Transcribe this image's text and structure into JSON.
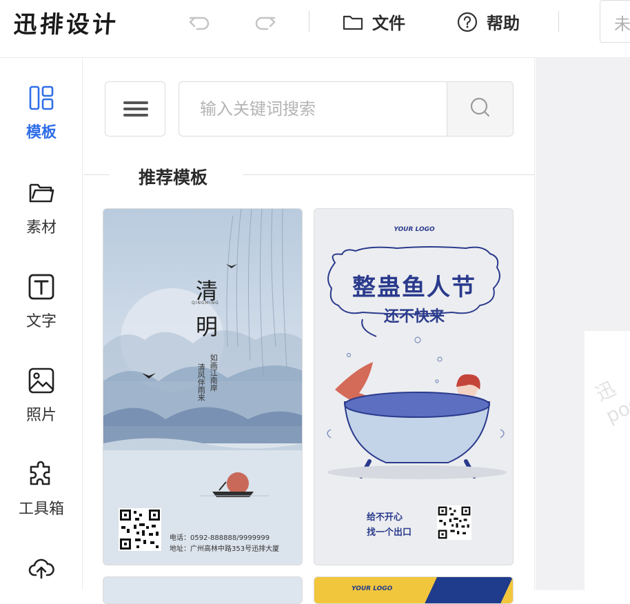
{
  "app": {
    "logo": "迅排设计",
    "title_placeholder": "未"
  },
  "toolbar": {
    "undo_icon": "undo-icon",
    "redo_icon": "redo-icon",
    "file_label": "文件",
    "help_label": "帮助"
  },
  "sidebar": {
    "items": [
      {
        "label": "模板",
        "icon": "template-grid-icon",
        "active": true
      },
      {
        "label": "素材",
        "icon": "folder-icon",
        "active": false
      },
      {
        "label": "文字",
        "icon": "text-t-icon",
        "active": false
      },
      {
        "label": "照片",
        "icon": "image-icon",
        "active": false
      },
      {
        "label": "工具箱",
        "icon": "puzzle-icon",
        "active": false
      },
      {
        "label": "",
        "icon": "cloud-upload-icon",
        "active": false
      }
    ]
  },
  "panel": {
    "search_placeholder": "输入关键词搜索",
    "section_title": "推荐模板"
  },
  "templates": [
    {
      "name": "qingming",
      "title_1": "清",
      "title_2": "明",
      "subtitle": "QINGMING",
      "poem": [
        "如画江南岸",
        "清风伴雨来"
      ],
      "phone": "电话：0592-888888/9999999",
      "address": "地址：广州高林中路353号迅排大厦"
    },
    {
      "name": "april-fools",
      "logo": "YOUR LOGO",
      "headline": "整蛊鱼人节",
      "sub": "还不快来",
      "tag_1": "给不开心",
      "tag_2": "找一个出口"
    },
    {
      "name": "partial-3"
    },
    {
      "name": "partial-4",
      "logo": "YOUR LOGO"
    }
  ],
  "canvas": {
    "watermark_1": "迅",
    "watermark_2": "pos"
  },
  "colors": {
    "accent": "#2f6ee8",
    "qingming_bg": "#c9d6e4",
    "fish_bg": "#ecedf0",
    "fish_text": "#2a3a8c"
  }
}
